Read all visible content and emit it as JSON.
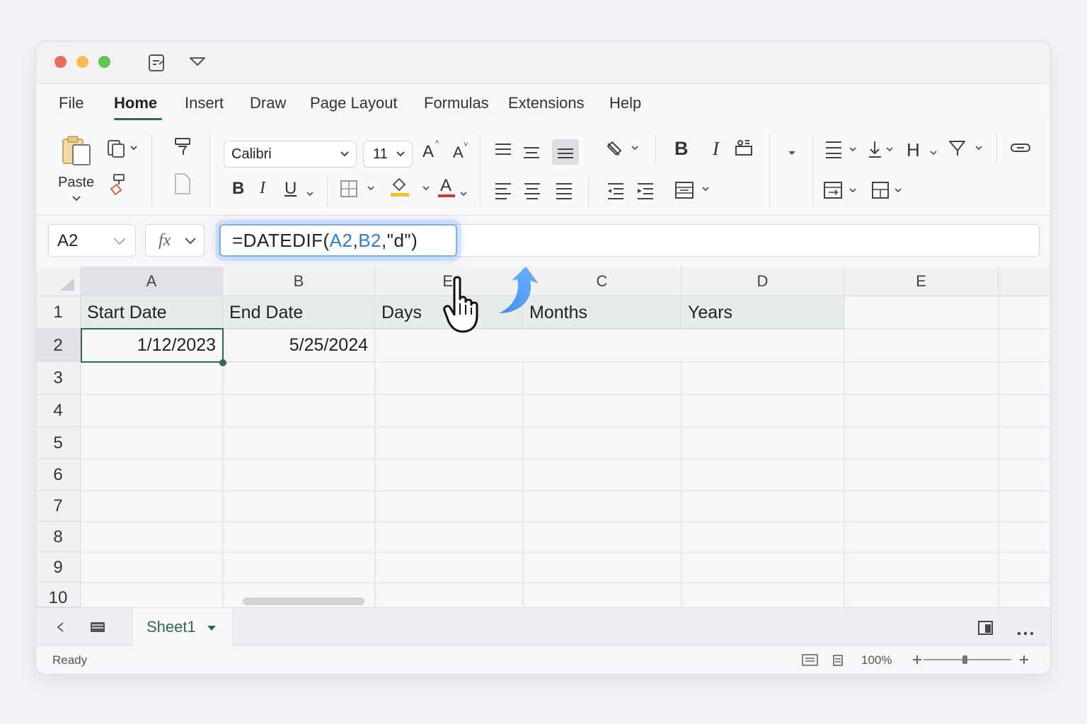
{
  "window": {
    "menu": [
      "File",
      "Home",
      "Insert",
      "Draw",
      "Page Layout",
      "Formulas",
      "Extensions",
      "Help"
    ],
    "active_menu": "Home"
  },
  "ribbon": {
    "paste_label": "Paste",
    "font_name": "Calibri",
    "font_size": "11",
    "bold_label": "B",
    "italic_label": "I",
    "underline_label": "U",
    "grow_font": "A",
    "shrink_font": "A",
    "font_color_label": "A",
    "ribbon_bold": "B",
    "ribbon_italic": "I",
    "heading_label": "H"
  },
  "formula_bar": {
    "name_box": "A2",
    "fx_label": "fx",
    "formula_prefix": "=DATEDIF(",
    "ref_a": "A2",
    "comma1": ",",
    "ref_b": "B2",
    "formula_suffix": ",\"d\")"
  },
  "columns": [
    "A",
    "B",
    "E",
    "C",
    "D",
    "E"
  ],
  "rows": [
    "1",
    "2",
    "3",
    "4",
    "5",
    "6",
    "7",
    "8",
    "9",
    "10"
  ],
  "cells": {
    "A1": "Start Date",
    "B1": "End Date",
    "C1": "Days",
    "D1": "Months",
    "E1": "Years",
    "A2": "1/12/2023",
    "B2": "5/25/2024"
  },
  "sheet_tabs": [
    "Sheet1"
  ],
  "status": {
    "ready": "Ready",
    "zoom": "100%",
    "zoom_level_percent": 100
  },
  "colors": {
    "accent_green": "#2f6b45",
    "ref_blue": "#2e7bd6",
    "header_fill": "#e6ece7"
  }
}
